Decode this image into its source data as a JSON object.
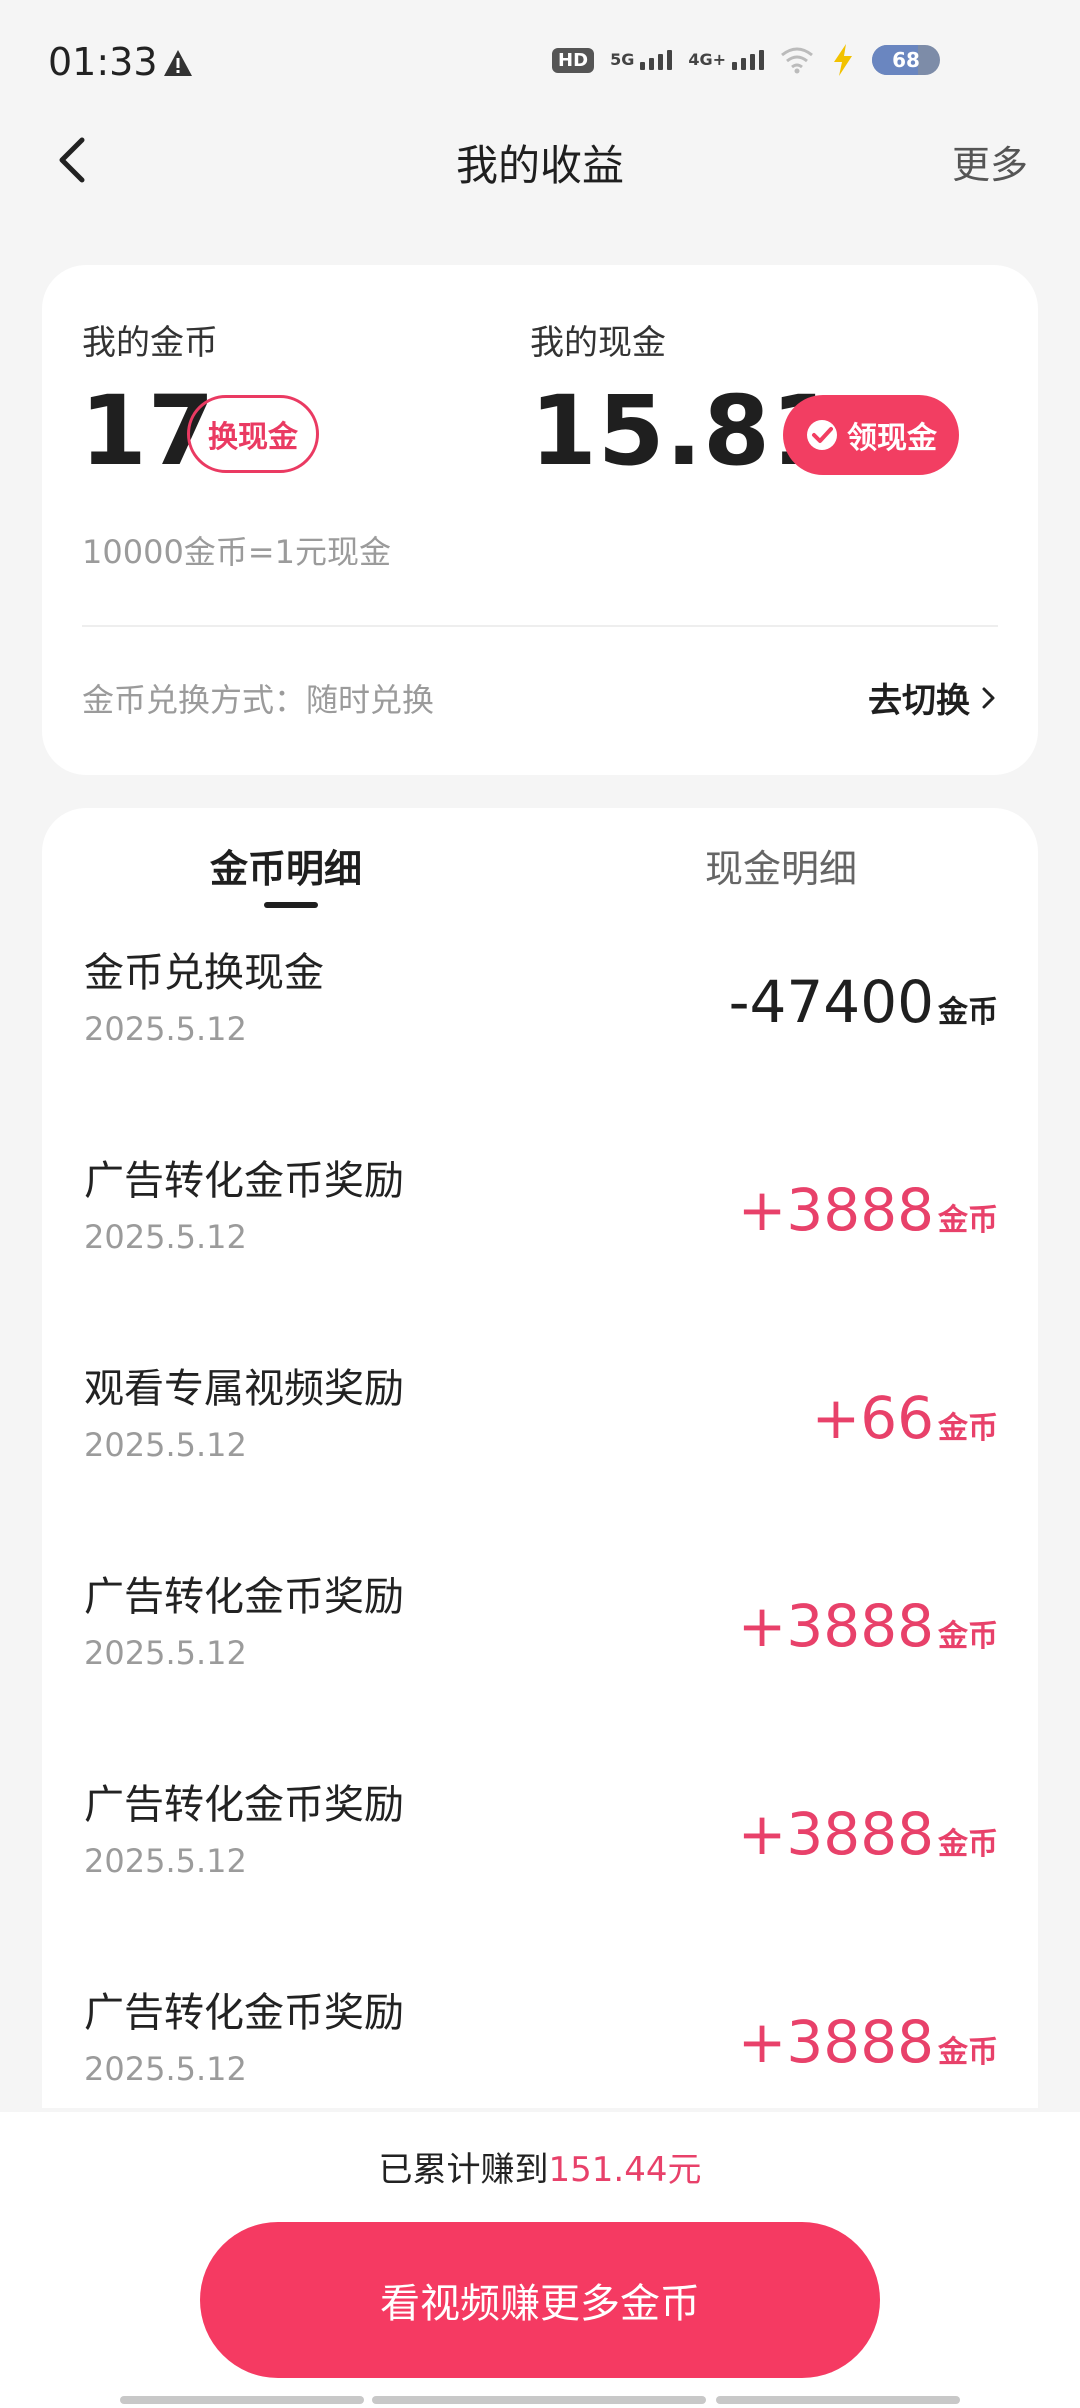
{
  "status": {
    "time": "01:33",
    "hd_label": "HD",
    "net1": "5G",
    "net2": "4G+",
    "battery": "68",
    "battery_level": 0.68
  },
  "nav": {
    "title": "我的收益",
    "more": "更多"
  },
  "summary": {
    "coins_label": "我的金币",
    "coins_value": "17",
    "exchange_button": "换现金",
    "cash_label": "我的现金",
    "cash_value": "15.81",
    "withdraw_button": "领现金",
    "rate": "10000金币=1元现金",
    "method": "金币兑换方式：随时兑换",
    "switch_label": "去切换"
  },
  "tabs": [
    "金币明细",
    "现金明细"
  ],
  "records": [
    {
      "title": "金币兑换现金",
      "date": "2025.5.12",
      "amount": "-47400",
      "unit": "金币"
    },
    {
      "title": "广告转化金币奖励",
      "date": "2025.5.12",
      "amount": "+3888",
      "unit": "金币"
    },
    {
      "title": "观看专属视频奖励",
      "date": "2025.5.12",
      "amount": "+66",
      "unit": "金币"
    },
    {
      "title": "广告转化金币奖励",
      "date": "2025.5.12",
      "amount": "+3888",
      "unit": "金币"
    },
    {
      "title": "广告转化金币奖励",
      "date": "2025.5.12",
      "amount": "+3888",
      "unit": "金币"
    },
    {
      "title": "广告转化金币奖励",
      "date": "2025.5.12",
      "amount": "+3888",
      "unit": "金币"
    }
  ],
  "footer": {
    "total_prefix": "已累计赚到",
    "total_value": "151.44元",
    "cta": "看视频赚更多金币"
  },
  "colors": {
    "accent": "#f23e62",
    "positive": "#e8416a",
    "background": "#f5f5f5"
  }
}
